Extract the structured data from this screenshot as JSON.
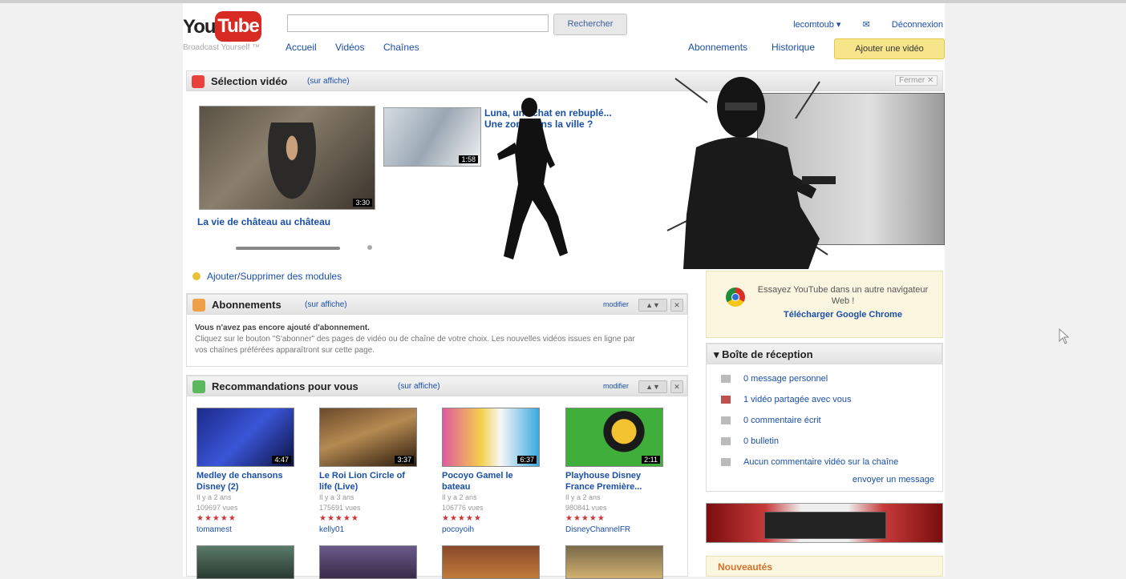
{
  "header": {
    "logo_you": "You",
    "logo_tube": "Tube",
    "tagline": "Broadcast Yourself ™",
    "search_placeholder": "",
    "search_button": "Rechercher",
    "nav": [
      "Accueil",
      "Vidéos",
      "Chaînes"
    ],
    "user_links": {
      "account": "lecomtoub ▾",
      "mail": "✉",
      "logout": "Déconnexion"
    },
    "right_nav": [
      "Abonnements",
      "Historique"
    ],
    "upload_button": "Ajouter une vidéo"
  },
  "featured": {
    "title": "Sélection vidéo",
    "subtitle": "(sur affiche)",
    "main_video_title": "La vie de château au château",
    "main_video_duration": "3:30",
    "small_video_title": "Luna, une chat en rebuplé... Une zone dans la ville ?",
    "small_video_duration": "1:58",
    "close_label": "Fermer ✕"
  },
  "add_remove_modules": "Ajouter/Supprimer des modules",
  "subscriptions": {
    "title": "Abonnements",
    "subtitle": "(sur affiche)",
    "ctrl_modify": "modifier",
    "ctrl_order": "▲▼",
    "ctrl_close": "✕",
    "text_bold": "Vous n'avez pas encore ajouté d'abonnement.",
    "text_body": "Cliquez sur le bouton \"S'abonner\" des pages de vidéo ou de chaîne de votre choix. Les nouvelles vidéos issues en ligne par vos chaînes préférées apparaîtront sur cette page."
  },
  "recommendations": {
    "title": "Recommandations pour vous",
    "subtitle": "(sur affiche)",
    "ctrl_modify": "modifier",
    "ctrl_order": "▲▼",
    "ctrl_close": "✕",
    "items": [
      {
        "title": "Medley de chansons Disney (2)",
        "date": "Il y a 2 ans",
        "views": "109697 vues",
        "stars": "★★★★★",
        "user": "tomamest",
        "duration": "4:47"
      },
      {
        "title": "Le Roi Lion Circle of life (Live)",
        "date": "Il y a 3 ans",
        "views": "175691 vues",
        "stars": "★★★★★",
        "user": "kelly01",
        "duration": "3:37"
      },
      {
        "title": "Pocoyo Gamel le bateau",
        "date": "Il y a 2 ans",
        "views": "106776 vues",
        "stars": "★★★★★",
        "user": "pocoyoih",
        "duration": "6:37"
      },
      {
        "title": "Playhouse Disney France Première...",
        "date": "Il y a 2 ans",
        "views": "980841 vues",
        "stars": "★★★★★",
        "user": "DisneyChannelFR",
        "duration": "2:11"
      }
    ]
  },
  "chrome_promo": {
    "text": "Essayez YouTube dans un autre navigateur Web !",
    "link": "Télécharger Google Chrome"
  },
  "inbox": {
    "title": "Boîte de réception",
    "items": [
      "0 message personnel",
      "1 vidéo partagée avec vous",
      "0 commentaire écrit",
      "0 bulletin",
      "Aucun commentaire vidéo sur la chaîne"
    ],
    "send_link": "envoyer un message"
  },
  "news": {
    "title": "Nouveautés"
  },
  "colors": {
    "brand_red": "#d72a23",
    "link_blue": "#1a4fa8",
    "upload_yellow": "#f6e58a",
    "featured_red": "#e8413a",
    "subs_orange": "#f0a04b",
    "rec_green": "#5cb85c"
  }
}
